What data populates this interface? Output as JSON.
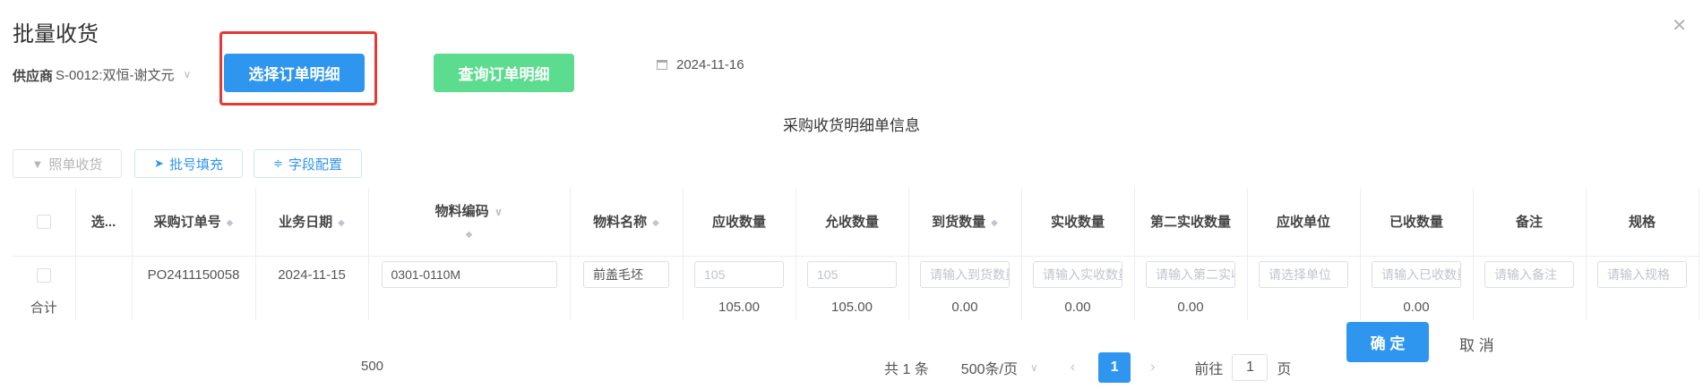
{
  "dialog": {
    "title": "批量收货",
    "close_icon": "close-icon"
  },
  "supplier": {
    "label": "供应商",
    "value": "S-0012:双恒-谢文元"
  },
  "buttons": {
    "select_order": "选择订单明细",
    "query_order": "查询订单明细",
    "confirm": "确 定",
    "cancel": "取 消"
  },
  "date": "2024-11-16",
  "section_title": "采购收货明细单信息",
  "toolbar": {
    "receive_by_order": "照单收货",
    "batch_fill": "批号填充",
    "field_config": "字段配置"
  },
  "table": {
    "headers": [
      "选...",
      "采购订单号",
      "业务日期",
      "物料编码",
      "物料名称",
      "应收数量",
      "允收数量",
      "到货数量",
      "实收数量",
      "第二实收数量",
      "应收单位",
      "已收数量",
      "备注",
      "规格"
    ],
    "row": {
      "order_no": "PO2411150058",
      "date": "2024-11-15",
      "material_code": "0301-0110M",
      "material_name": "前盖毛坯",
      "due_qty": "105",
      "allow_qty": "105",
      "arrive_placeholder": "请输入到货数量",
      "actual_placeholder": "请输入实收数量",
      "second_placeholder": "请输入第二实收数量",
      "unit_placeholder": "请选择单位",
      "received_placeholder": "请输入已收数量",
      "remark_placeholder": "请输入备注",
      "spec_placeholder": "请输入规格"
    },
    "summary": {
      "label": "合计",
      "due": "105.00",
      "allow": "105.00",
      "arrive": "0.00",
      "actual": "0.00",
      "second": "0.00",
      "received": "0.00"
    }
  },
  "pagination": {
    "left_value": "500",
    "total": "共 1 条",
    "page_size": "500条/页",
    "current": "1",
    "goto_label": "前往",
    "goto_value": "1",
    "page_suffix": "页"
  }
}
